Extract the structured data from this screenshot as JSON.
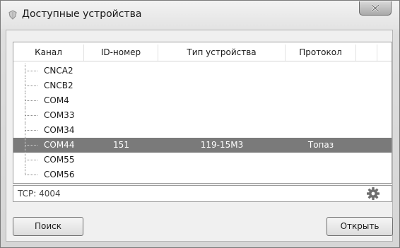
{
  "window": {
    "title": "Доступные устройства",
    "app_icon": "shield-icon",
    "close_icon": "close-icon"
  },
  "table": {
    "columns": [
      "Канал",
      "ID-номер",
      "Тип устройства",
      "Протокол"
    ],
    "rows": [
      {
        "channel": "CNCA2",
        "id": "",
        "type": "",
        "protocol": ""
      },
      {
        "channel": "CNCB2",
        "id": "",
        "type": "",
        "protocol": ""
      },
      {
        "channel": "COM4",
        "id": "",
        "type": "",
        "protocol": ""
      },
      {
        "channel": "COM33",
        "id": "",
        "type": "",
        "protocol": ""
      },
      {
        "channel": "COM34",
        "id": "",
        "type": "",
        "protocol": ""
      },
      {
        "channel": "COM44",
        "id": "151",
        "type": "119-15М3",
        "protocol": "Топаз"
      },
      {
        "channel": "COM55",
        "id": "",
        "type": "",
        "protocol": ""
      },
      {
        "channel": "COM56",
        "id": "",
        "type": "",
        "protocol": ""
      }
    ],
    "selected_channel": "COM44"
  },
  "status": {
    "text": "TCP: 4004",
    "settings_icon": "gear-icon"
  },
  "buttons": {
    "search": "Поиск",
    "open": "Открыть"
  },
  "colors": {
    "selection": "#7a7a7a",
    "window_bg": "#f0f0f0"
  }
}
